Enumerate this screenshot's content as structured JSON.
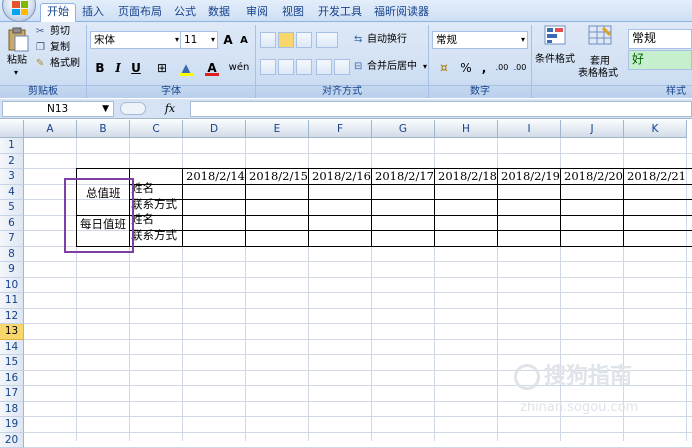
{
  "menubar": {
    "tabs": [
      "开始",
      "插入",
      "页面布局",
      "公式",
      "数据",
      "审阅",
      "视图",
      "开发工具",
      "福昕阅读器"
    ],
    "active_tab": "开始"
  },
  "ribbon": {
    "clipboard": {
      "paste": "粘贴",
      "cut": "剪切",
      "copy": "复制",
      "format_painter": "格式刷",
      "group": "剪贴板"
    },
    "font": {
      "name": "宋体",
      "size": "11",
      "bold": "B",
      "italic": "I",
      "underline": "U",
      "grow": "A",
      "shrink": "A",
      "phonetic": "wén",
      "group": "字体"
    },
    "alignment": {
      "wrap": "自动换行",
      "merge": "合并后居中",
      "group": "对齐方式"
    },
    "number": {
      "format": "常规",
      "percent": "%",
      "comma": ",",
      "dec_inc": ".00",
      "dec_dec": ".00",
      "group": "数字"
    },
    "styles": {
      "conditional": "条件格式",
      "table_format_1": "套用",
      "table_format_2": "表格格式",
      "style_normal": "常规",
      "style_good": "好",
      "group": "样式"
    }
  },
  "formula_bar": {
    "name_box": "N13",
    "fx": "fx",
    "content": ""
  },
  "sheet": {
    "columns": [
      "A",
      "B",
      "C",
      "D",
      "E",
      "F",
      "G",
      "H",
      "I",
      "J",
      "K"
    ],
    "rows": [
      "1",
      "2",
      "3",
      "4",
      "5",
      "6",
      "7",
      "8",
      "9",
      "10",
      "11",
      "12",
      "13",
      "14",
      "15",
      "16",
      "17",
      "18",
      "19",
      "20"
    ],
    "selected_row": "13",
    "dates": [
      "2018/2/14",
      "2018/2/15",
      "2018/2/16",
      "2018/2/17",
      "2018/2/18",
      "2018/2/19",
      "2018/2/20",
      "2018/2/21"
    ],
    "b4": "总值班",
    "b6": "每日值班",
    "c4": "姓名",
    "c5": "联系方式",
    "c6": "姓名",
    "c7": "联系方式"
  },
  "watermark": {
    "line1": "搜狗指南",
    "line2": "zhinan.sogou.com"
  },
  "colors": {
    "accent": "#15428b",
    "ribbon": "#d2e1f4",
    "highlight_border": "#7d3fa6",
    "selected_row": "#f8d66a"
  }
}
